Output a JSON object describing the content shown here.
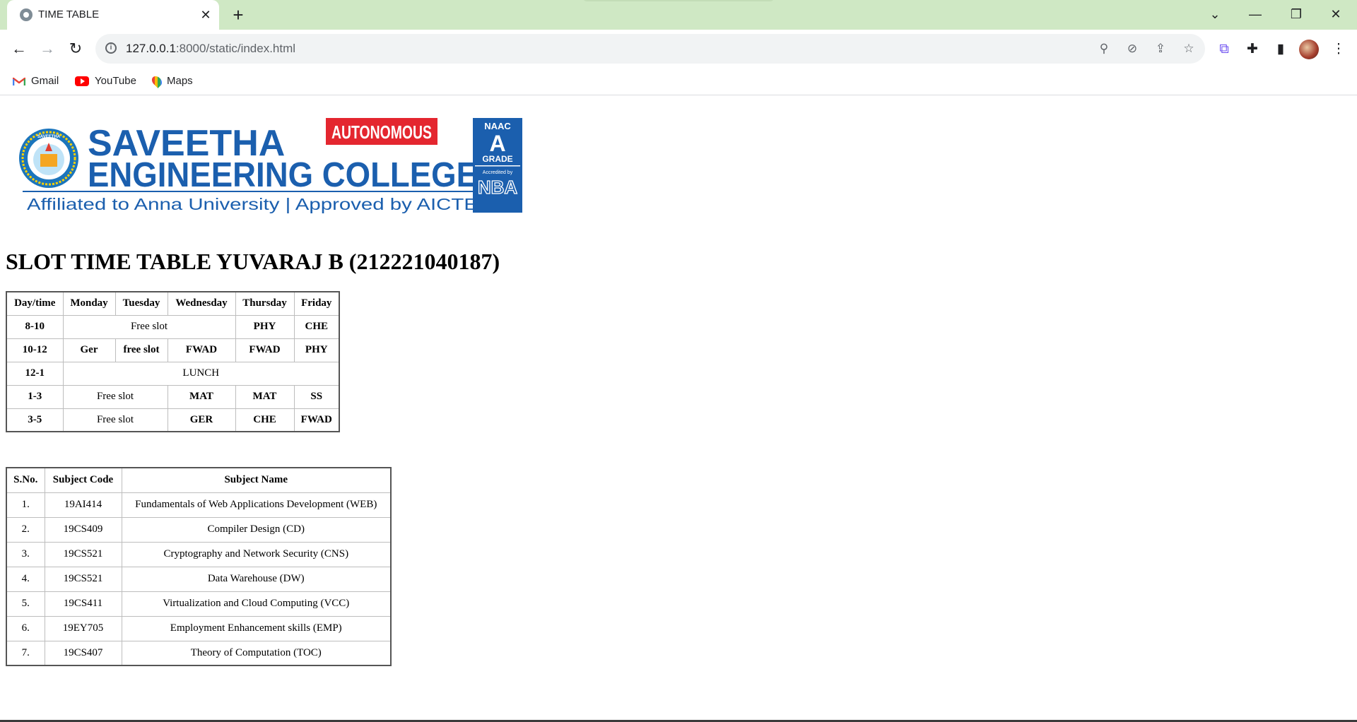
{
  "browser": {
    "tab_title": "TIME TABLE",
    "tab_close": "✕",
    "new_tab": "+",
    "url_host": "127.0.0.1",
    "url_path": ":8000/static/index.html",
    "bookmarks": [
      "Gmail",
      "YouTube",
      "Maps"
    ]
  },
  "logo": {
    "name_line1": "SAVEETHA",
    "name_line2": "ENGINEERING COLLEGE",
    "tagline": "Affiliated to Anna University | Approved by AICTE",
    "badge": "AUTONOMOUS",
    "naac": "NAAC",
    "grade_letter": "A",
    "grade": "GRADE",
    "accredited": "Accredited by",
    "nba": "NBA",
    "seal_text": "SAVEETHA"
  },
  "page": {
    "title": "SLOT TIME TABLE YUVARAJ B (212221040187)"
  },
  "timetable": {
    "headers": [
      "Day/time",
      "Monday",
      "Tuesday",
      "Wednesday",
      "Thursday",
      "Friday"
    ],
    "r1": {
      "time": "8-10",
      "free": "Free slot",
      "thu": "PHY",
      "fri": "CHE"
    },
    "r2": {
      "time": "10-12",
      "mon": "Ger",
      "tue": "free slot",
      "wed": "FWAD",
      "thu": "FWAD",
      "fri": "PHY"
    },
    "r3": {
      "time": "12-1",
      "lunch": "LUNCH"
    },
    "r4": {
      "time": "1-3",
      "free": "Free slot",
      "wed": "MAT",
      "thu": "MAT",
      "fri": "SS"
    },
    "r5": {
      "time": "3-5",
      "free": "Free slot",
      "wed": "GER",
      "thu": "CHE",
      "fri": "FWAD"
    }
  },
  "subjects": {
    "headers": [
      "S.No.",
      "Subject Code",
      "Subject Name"
    ],
    "rows": [
      [
        "1.",
        "19AI414",
        "Fundamentals of Web Applications Development (WEB)"
      ],
      [
        "2.",
        "19CS409",
        "Compiler Design (CD)"
      ],
      [
        "3.",
        "19CS521",
        "Cryptography and Network Security (CNS)"
      ],
      [
        "4.",
        "19CS521",
        "Data Warehouse (DW)"
      ],
      [
        "5.",
        "19CS411",
        "Virtualization and Cloud Computing (VCC)"
      ],
      [
        "6.",
        "19EY705",
        "Employment Enhancement skills (EMP)"
      ],
      [
        "7.",
        "19CS407",
        "Theory of Computation (TOC)"
      ]
    ]
  }
}
